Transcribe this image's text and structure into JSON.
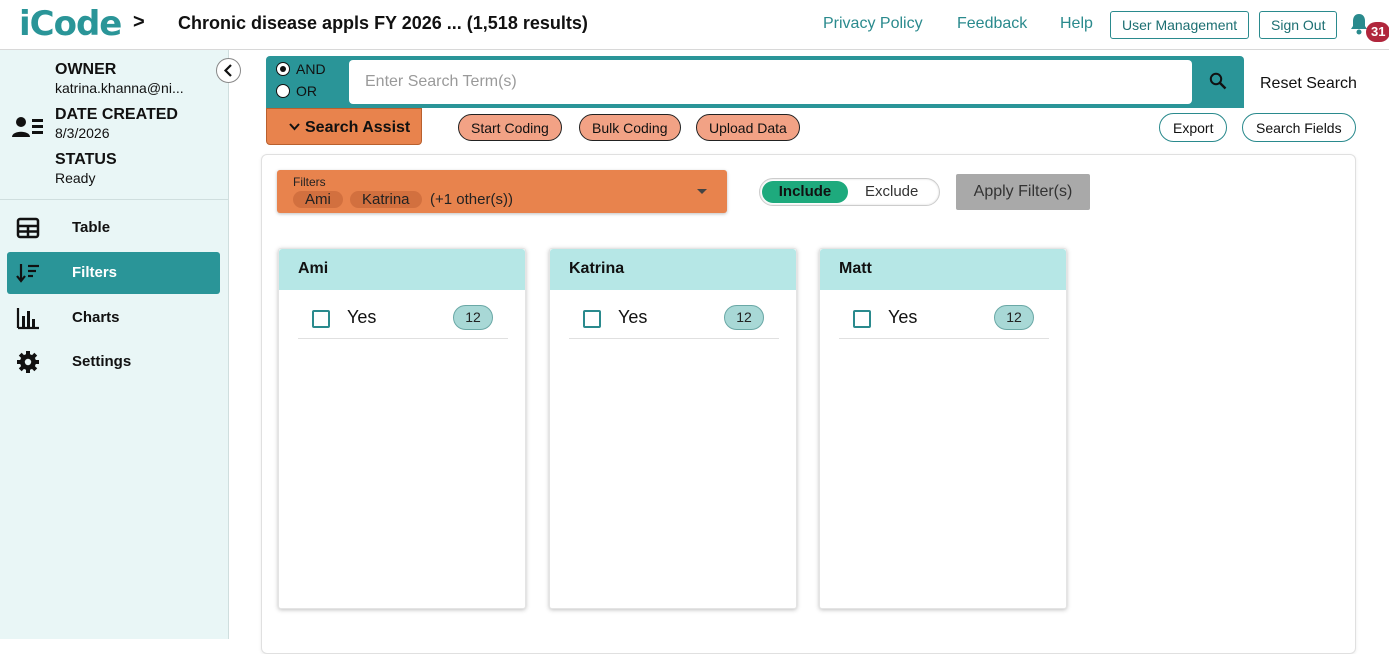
{
  "app": {
    "logo_text": "iCode",
    "brand_color": "#2a9598",
    "accent_orange": "#e8834d"
  },
  "header": {
    "breadcrumb_icon": "chevron-right-icon",
    "title": "Chronic disease appls FY 2026 ... (1,518 results)",
    "links": {
      "privacy": "Privacy Policy",
      "feedback": "Feedback",
      "help": "Help"
    },
    "buttons": {
      "user_management": "User Management",
      "sign_out": "Sign Out"
    },
    "notifications": {
      "icon": "bell-icon",
      "count": "31"
    }
  },
  "sidebar": {
    "owner_key": "OWNER",
    "owner_val": "katrina.khanna@ni...",
    "date_key": "DATE CREATED",
    "date_val": "8/3/2026",
    "status_key": "STATUS",
    "status_val": "Ready",
    "items": [
      {
        "label": "Table",
        "icon": "table-icon"
      },
      {
        "label": "Filters",
        "icon": "sort-filter-icon",
        "active": true
      },
      {
        "label": "Charts",
        "icon": "bar-chart-icon"
      },
      {
        "label": "Settings",
        "icon": "gear-icon"
      }
    ]
  },
  "search": {
    "and_label": "AND",
    "or_label": "OR",
    "selected_operator": "AND",
    "placeholder": "Enter Search Term(s)",
    "value": "",
    "reset_label": "Reset Search"
  },
  "toolbar": {
    "search_assist": "Search Assist",
    "start_coding": "Start Coding",
    "bulk_coding": "Bulk Coding",
    "upload_data": "Upload Data",
    "export": "Export",
    "search_fields": "Search Fields"
  },
  "filter_bar": {
    "label": "Filters",
    "chips": [
      "Ami",
      "Katrina"
    ],
    "more": "(+1 other(s))",
    "include_label": "Include",
    "exclude_label": "Exclude",
    "mode": "Include",
    "apply_label": "Apply Filter(s)"
  },
  "cards": [
    {
      "title": "Ami",
      "options": [
        {
          "label": "Yes",
          "count": "12",
          "checked": false
        }
      ]
    },
    {
      "title": "Katrina",
      "options": [
        {
          "label": "Yes",
          "count": "12",
          "checked": false
        }
      ]
    },
    {
      "title": "Matt",
      "options": [
        {
          "label": "Yes",
          "count": "12",
          "checked": false
        }
      ]
    }
  ]
}
